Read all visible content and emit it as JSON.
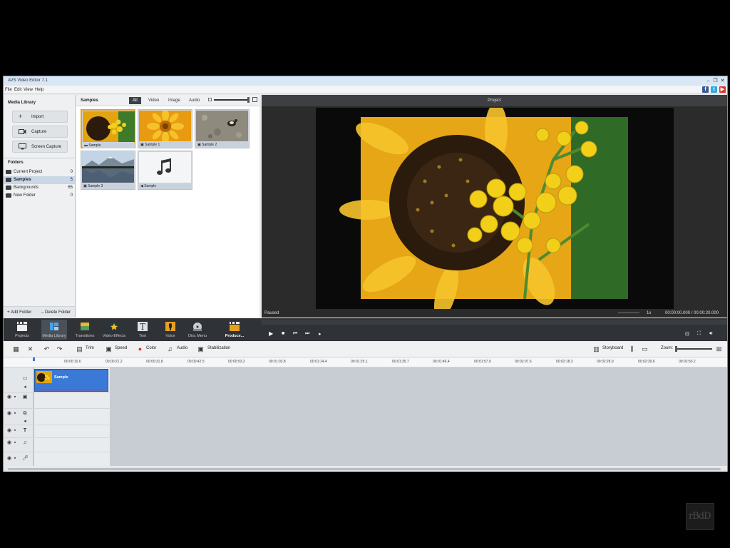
{
  "window": {
    "title": "AVS Video Editor 7.1"
  },
  "menu": [
    "File",
    "Edit",
    "View",
    "Help"
  ],
  "media_library": {
    "heading": "Media Library",
    "buttons": [
      {
        "label": "Import",
        "icon": "plus-icon"
      },
      {
        "label": "Capture",
        "icon": "camera-icon"
      },
      {
        "label": "Screen Capture",
        "icon": "monitor-icon"
      }
    ],
    "folders_heading": "Folders",
    "folders": [
      {
        "name": "Current Project",
        "count": "0"
      },
      {
        "name": "Samples",
        "count": "5"
      },
      {
        "name": "Backgrounds",
        "count": "65"
      },
      {
        "name": "New Folder",
        "count": "0"
      }
    ],
    "add_folder": "Add Folder",
    "delete_folder": "Delete Folder"
  },
  "samples": {
    "heading": "Samples",
    "filters": [
      "All",
      "Video",
      "Image",
      "Audio"
    ],
    "items": [
      {
        "label": "Sample",
        "kind": "video"
      },
      {
        "label": "Sample 1",
        "kind": "image"
      },
      {
        "label": "Sample 2",
        "kind": "image"
      },
      {
        "label": "Sample 3",
        "kind": "image"
      },
      {
        "label": "Sample",
        "kind": "audio"
      }
    ]
  },
  "preview": {
    "heading": "Project",
    "status": "Paused",
    "speed": "1x",
    "time": "00:00:00.000 / 00:00:20.000"
  },
  "toolbar": [
    {
      "label": "Projects",
      "icon": "clapper-icon"
    },
    {
      "label": "Media Library",
      "icon": "media-library-icon"
    },
    {
      "label": "Transitions",
      "icon": "transitions-icon"
    },
    {
      "label": "Video Effects",
      "icon": "video-effects-icon"
    },
    {
      "label": "Text",
      "icon": "text-icon"
    },
    {
      "label": "Voice",
      "icon": "microphone-icon"
    },
    {
      "label": "Disc Menu",
      "icon": "disc-icon"
    },
    {
      "label": "Produce...",
      "icon": "produce-icon"
    }
  ],
  "timeline_tools": {
    "trim": "Trim",
    "speed": "Speed",
    "color": "Color",
    "audio": "Audio",
    "stabilization": "Stabilization",
    "storyboard": "Storyboard",
    "zoom": "Zoom:"
  },
  "ruler": [
    "00:00:10.6",
    "00:00:21.2",
    "00:00:31.8",
    "00:00:42.5",
    "00:00:53.2",
    "00:01:03.8",
    "00:01:14.4",
    "00:01:25.1",
    "00:01:35.7",
    "00:01:46.4",
    "00:01:57.0",
    "00:02:07.6",
    "00:02:18.3",
    "00:02:28.9",
    "00:02:39.6",
    "00:02:50.2"
  ],
  "clip": {
    "label": "Sample"
  },
  "colors": {
    "accent": "#3a7ad6",
    "dark_toolbar": "#2f3236",
    "selection": "#e8a020"
  }
}
